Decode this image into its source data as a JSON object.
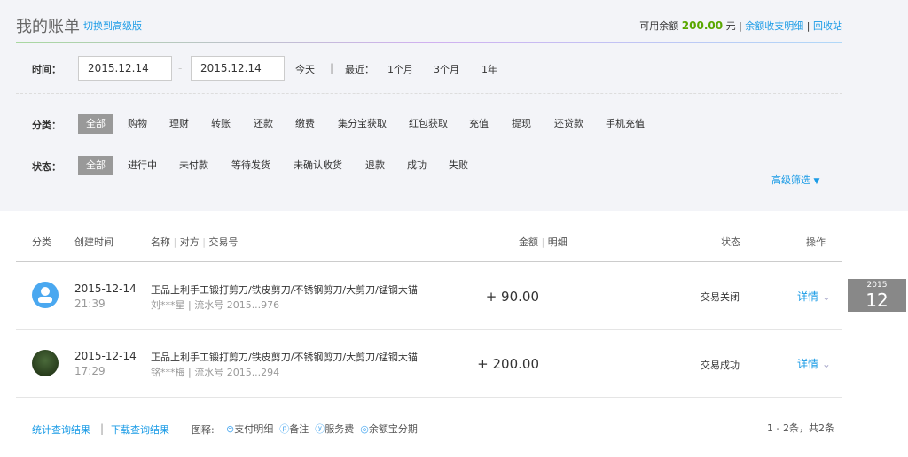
{
  "header": {
    "title": "我的账单",
    "switch_link": "切换到高级版",
    "balance_label": "可用余额",
    "balance_value": "200.00",
    "balance_unit": "元",
    "detail_link": "余额收支明细",
    "recycle_link": "回收站",
    "balance_color": "#5aa700"
  },
  "filters": {
    "time_label": "时间：",
    "start_date": "2015.12.14",
    "end_date": "2015.12.14",
    "today": "今天",
    "recent_label": "最近：",
    "ranges": [
      "1个月",
      "3个月",
      "1年"
    ],
    "category_label": "分类：",
    "categories": [
      "全部",
      "购物",
      "理财",
      "转账",
      "还款",
      "缴费",
      "集分宝获取",
      "红包获取",
      "充值",
      "提现",
      "还贷款",
      "手机充值"
    ],
    "status_label": "状态：",
    "statuses": [
      "全部",
      "进行中",
      "未付款",
      "等待发货",
      "未确认收货",
      "退款",
      "成功",
      "失败"
    ],
    "advanced": "高级筛选"
  },
  "table": {
    "headers": {
      "category": "分类",
      "created": "创建时间",
      "name": "名称",
      "party": "对方",
      "txn": "交易号",
      "amount": "金额",
      "detail": "明细",
      "status": "状态",
      "action": "操作"
    },
    "rows": [
      {
        "date": "2015-12-14",
        "time": "21:39",
        "name": "正品上利手工锻打剪刀/铁皮剪刀/不锈钢剪刀/大剪刀/锰钢大锚",
        "sub": "刘***星 | 流水号 2015...976",
        "amount": "+ 90.00",
        "status": "交易关闭",
        "action": "详情"
      },
      {
        "date": "2015-12-14",
        "time": "17:29",
        "name": "正品上利手工锻打剪刀/铁皮剪刀/不锈钢剪刀/大剪刀/锰钢大锚",
        "sub": "铭***梅 | 流水号 2015...294",
        "amount": "+ 200.00",
        "status": "交易成功",
        "action": "详情"
      }
    ]
  },
  "date_badge": {
    "year": "2015",
    "month": "12"
  },
  "footer": {
    "stats_link": "统计查询结果",
    "download_link": "下载查询结果",
    "legend_label": "图释:",
    "legend": [
      "支付明细",
      "备注",
      "服务费",
      "余额宝分期"
    ],
    "pagination": "1 - 2条，共2条"
  }
}
